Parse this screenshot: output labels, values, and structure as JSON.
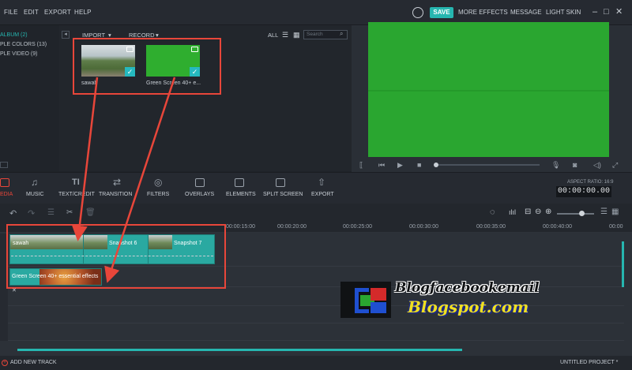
{
  "menubar": {
    "file": "FILE",
    "edit": "EDIT",
    "export": "EXPORT",
    "help": "HELP",
    "save": "SAVE",
    "more_effects": "MORE EFFECTS",
    "message": "MESSAGE",
    "light_skin": "LIGHT SKIN"
  },
  "library": {
    "categories": [
      "ALBUM (2)",
      "PLE COLORS (13)",
      "PLE VIDEO (9)"
    ],
    "import": "IMPORT",
    "record": "RECORD",
    "all": "ALL",
    "search_placeholder": "Search",
    "items": [
      {
        "label": "sawah"
      },
      {
        "label": "Green Screen 40+ e..."
      }
    ]
  },
  "toolbar": {
    "tools": [
      "EDIA",
      "MUSIC",
      "TEXT/CREDIT",
      "TRANSITION",
      "FILTERS",
      "OVERLAYS",
      "ELEMENTS",
      "SPLIT SCREEN",
      "EXPORT"
    ],
    "aspect_ratio": "ASPECT RATIO: 16:9",
    "timecode": "00:00:00.00"
  },
  "ruler": {
    "ticks": [
      "00:00:15:00",
      "00:00:20:00",
      "00:00:25:00",
      "00:00:30:00",
      "00:00:35:00",
      "00:00:40:00",
      "00:00"
    ]
  },
  "timeline": {
    "video_clips": [
      "sawah",
      "Snapshot 6",
      "Snapshot 7"
    ],
    "pip_clip": "Green Screen 40+ essential effects"
  },
  "watermark": {
    "line1": "Blogfacebookemail",
    "line2": "Blogspot.com"
  },
  "status": {
    "add_track": "ADD NEW TRACK",
    "project": "UNTITLED PROJECT *"
  },
  "colors": {
    "accent": "#26b6b0",
    "annotation": "#e8463a",
    "green_screen": "#2aa630"
  }
}
